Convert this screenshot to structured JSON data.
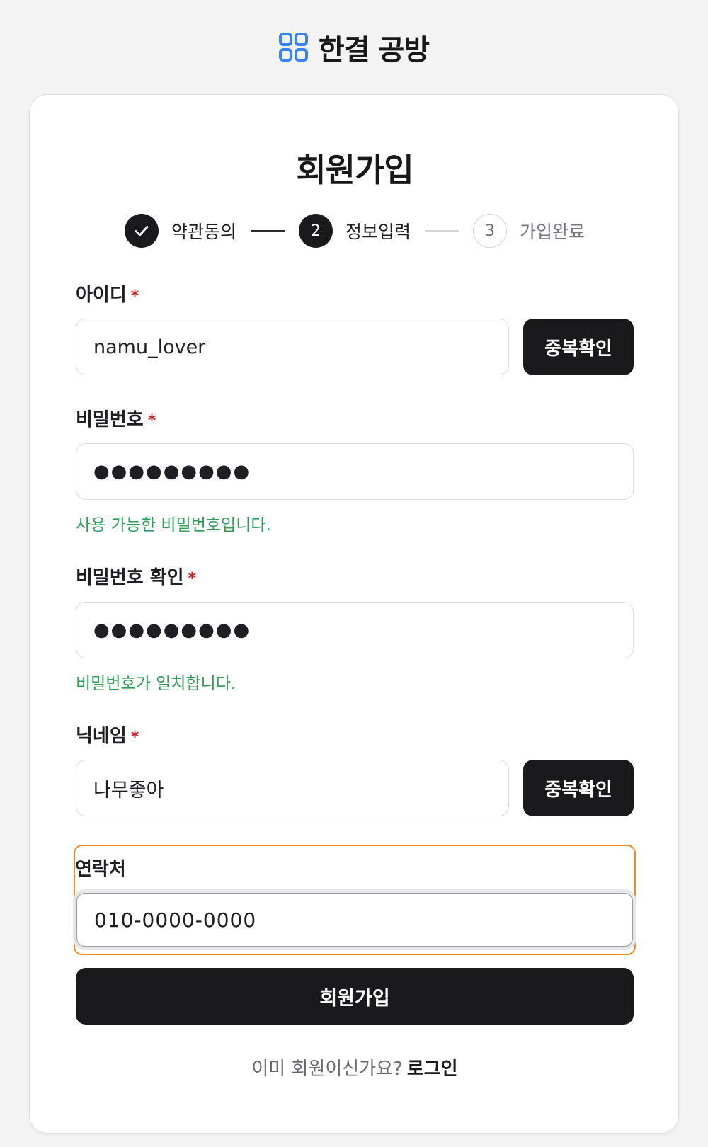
{
  "brand": {
    "name": "한결 공방",
    "accent_color": "#3b82f6"
  },
  "signup": {
    "title": "회원가입",
    "steps": [
      {
        "number": "1",
        "label": "약관동의",
        "status": "done"
      },
      {
        "number": "2",
        "label": "정보입력",
        "status": "active"
      },
      {
        "number": "3",
        "label": "가입완료",
        "status": "pending"
      }
    ],
    "fields": {
      "username": {
        "label": "아이디",
        "required_mark": "*",
        "value": "namu_lover",
        "button_label": "중복확인"
      },
      "password": {
        "label": "비밀번호",
        "required_mark": "*",
        "value": "●●●●●●●●●",
        "hint": "사용 가능한 비밀번호입니다."
      },
      "password_confirm": {
        "label": "비밀번호 확인",
        "required_mark": "*",
        "value": "●●●●●●●●●",
        "hint": "비밀번호가 일치합니다."
      },
      "nickname": {
        "label": "닉네임",
        "required_mark": "*",
        "value": "나무좋아",
        "button_label": "중복확인"
      },
      "phone": {
        "label": "연락처",
        "value": "010-0000-0000"
      }
    },
    "submit_label": "회원가입",
    "login_prompt": "이미 회원이신가요?",
    "login_link": "로그인"
  },
  "colors": {
    "primary_dark": "#1a1a1d",
    "success_text": "#2e9e56",
    "required_mark": "#c81e1e",
    "focus_outline": "#f08a1c"
  }
}
